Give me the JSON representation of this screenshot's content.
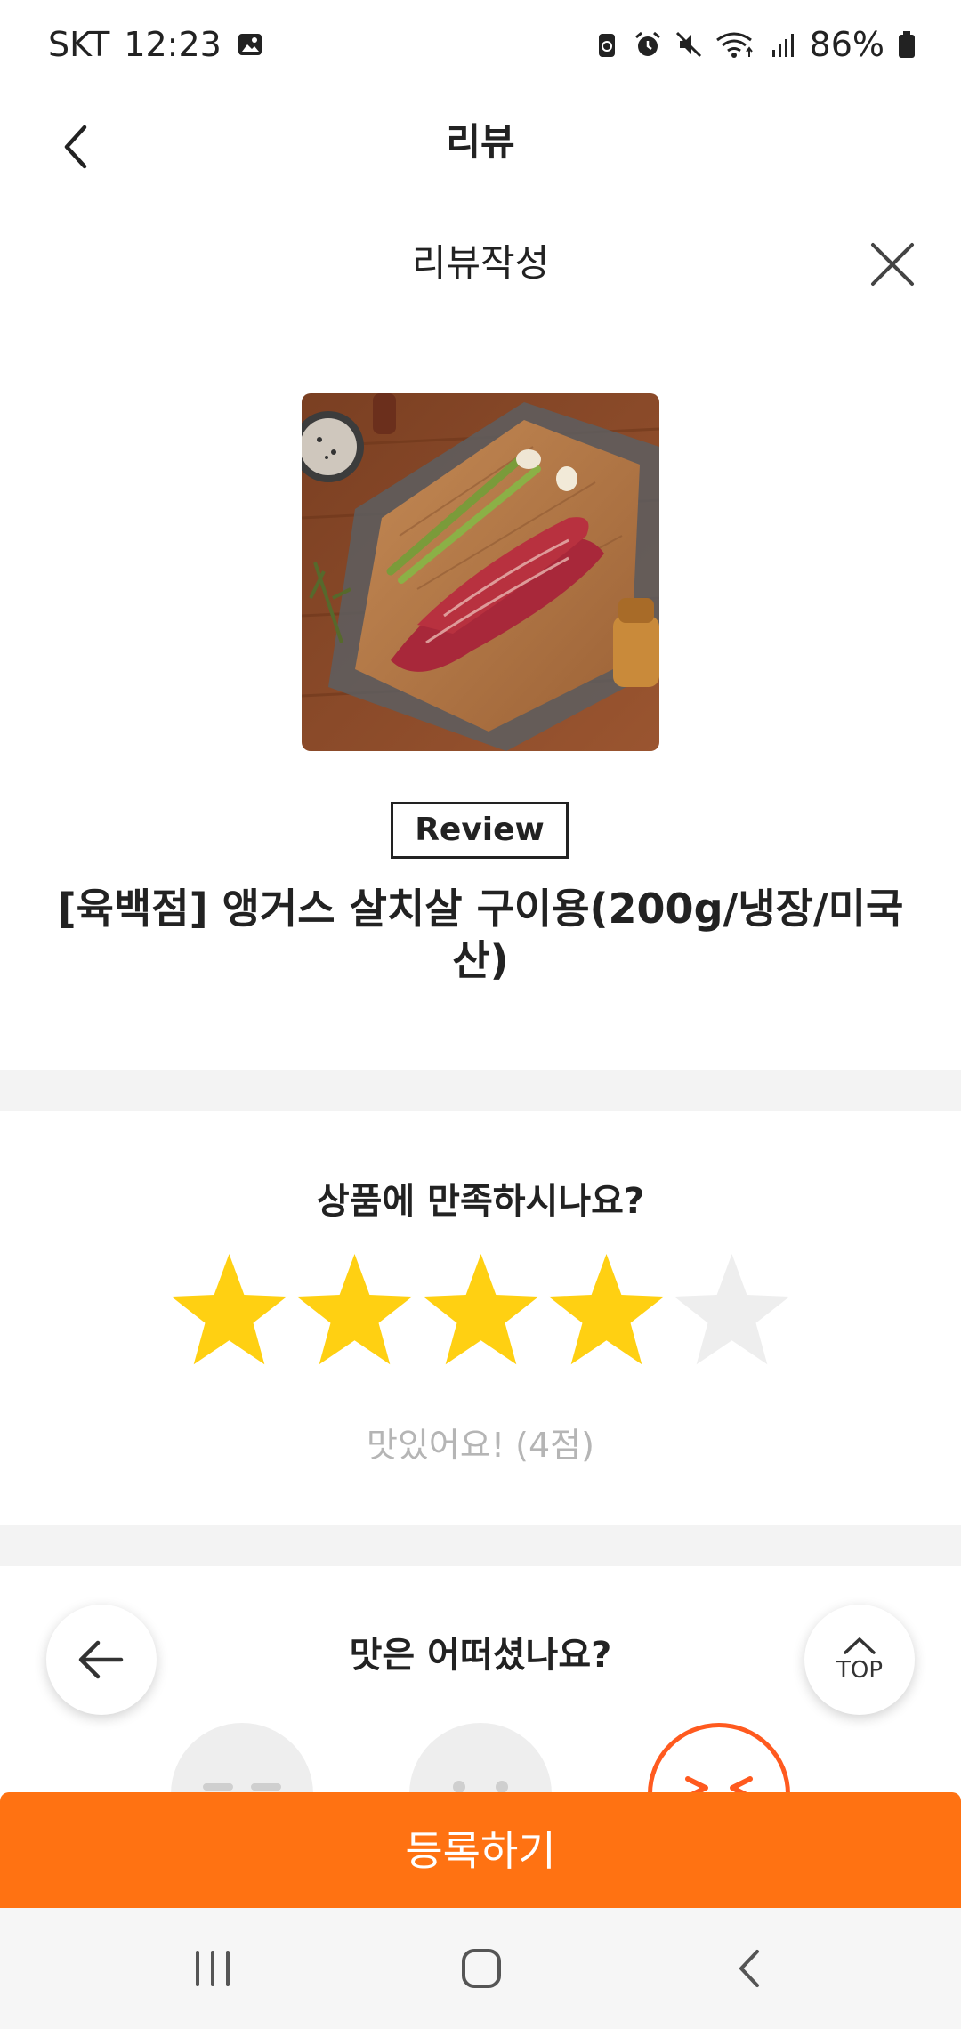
{
  "status_bar": {
    "carrier": "SKT",
    "time": "12:23",
    "battery": "86%"
  },
  "header": {
    "title": "리뷰"
  },
  "sheet": {
    "title": "리뷰작성"
  },
  "product": {
    "badge": "Review",
    "name": "[육백점] 앵거스 살치살 구이용(200g/냉장/미국산)"
  },
  "satisfaction": {
    "question": "상품에 만족하시나요?",
    "rating": 4,
    "max_rating": 5,
    "rating_label": "맛있어요! (4점)",
    "star_color": "#FFD012",
    "star_empty_color": "#EEEEEE"
  },
  "taste": {
    "question": "맛은 어떠셨나요?",
    "accent_color": "#FF5A1F"
  },
  "floating": {
    "back_icon": "arrow-left-icon",
    "top_label": "TOP"
  },
  "submit": {
    "label": "등록하기",
    "color": "#FF7212"
  },
  "nav": {
    "icons": [
      "recent-apps-icon",
      "home-icon",
      "back-icon"
    ]
  }
}
